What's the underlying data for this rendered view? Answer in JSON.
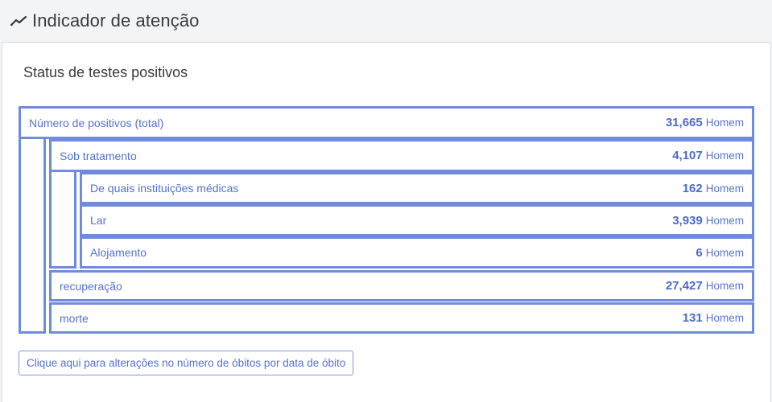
{
  "header": {
    "title": "Indicador de atenção",
    "icon": "trend-line-icon"
  },
  "card": {
    "title": "Status de testes positivos"
  },
  "rows": [
    {
      "label": "Número de positivos (total)",
      "value": "31,665",
      "unit": "Homem"
    },
    {
      "label": "Sob tratamento",
      "value": "4,107",
      "unit": "Homem"
    },
    {
      "label": "De quais instituições médicas",
      "value": "162",
      "unit": "Homem"
    },
    {
      "label": "Lar",
      "value": "3,939",
      "unit": "Homem"
    },
    {
      "label": "Alojamento",
      "value": "6",
      "unit": "Homem"
    },
    {
      "label": "recuperação",
      "value": "27,427",
      "unit": "Homem"
    },
    {
      "label": "morte",
      "value": "131",
      "unit": "Homem"
    }
  ],
  "link_button": "Clique aqui para alterações no número de óbitos por data de óbito",
  "colors": {
    "accent": "#6f8bdc",
    "text_accent": "#5472c9"
  }
}
